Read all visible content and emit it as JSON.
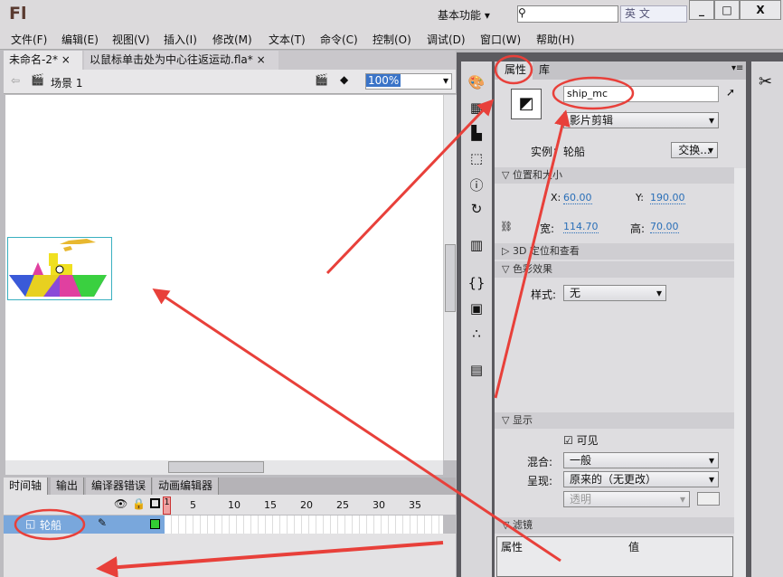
{
  "app": {
    "logo": "Fl",
    "workspace": "基本功能",
    "ime": "英 文",
    "window_buttons": [
      "_",
      "□",
      "X"
    ]
  },
  "menu": [
    "文件(F)",
    "编辑(E)",
    "视图(V)",
    "插入(I)",
    "修改(M)",
    "文本(T)",
    "命令(C)",
    "控制(O)",
    "调试(D)",
    "窗口(W)",
    "帮助(H)"
  ],
  "doc_tabs": [
    {
      "label": "未命名-2*",
      "close": "×"
    },
    {
      "label": "以鼠标单击处为中心往返运动.fla*",
      "close": "×"
    }
  ],
  "scene": {
    "label": "场景 1",
    "zoom": "100%"
  },
  "timeline": {
    "tabs": [
      "时间轴",
      "输出",
      "编译器错误",
      "动画编辑器"
    ],
    "frame_numbers": [
      "1",
      "5",
      "10",
      "15",
      "20",
      "25",
      "30",
      "35"
    ],
    "layer": "轮船"
  },
  "properties": {
    "tabs": [
      "属性",
      "库"
    ],
    "instance_name": "ship_mc",
    "symbol_type": "影片剪辑",
    "instance_label": "实例：轮船",
    "swap_button": "交换...",
    "sections": {
      "position": "位置和大小",
      "3d": "3D 定位和查看",
      "color": "色彩效果",
      "display": "显示",
      "filters": "滤镜"
    },
    "x_label": "X:",
    "x": "60.00",
    "y_label": "Y:",
    "y": "190.00",
    "w_label": "宽:",
    "w": "114.70",
    "h_label": "高:",
    "h": "70.00",
    "style_label": "样式:",
    "style": "无",
    "visible_label": "可见",
    "blend_label": "混合:",
    "blend": "一般",
    "render_label": "呈现:",
    "render": "原来的（无更改）",
    "transparent": "透明",
    "filter_cols": [
      "属性",
      "值"
    ]
  },
  "annotation_color": "#e8403a"
}
